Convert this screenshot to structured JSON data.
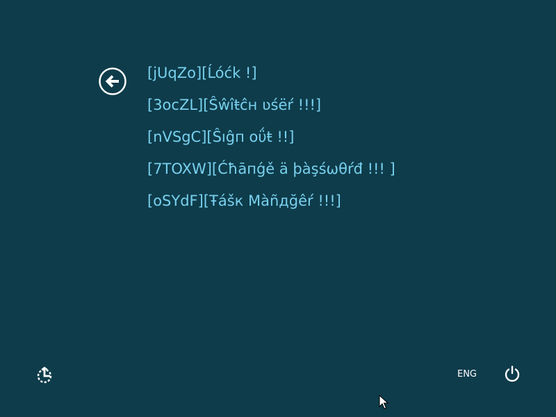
{
  "menu": {
    "items": [
      {
        "label": "[jUqZo][Ĺóćk !]"
      },
      {
        "label": "[3ocZL][Ŝŵîŧĉн ʋśëŕ !!!]"
      },
      {
        "label": "[nVSgC][Ŝıĝп oΰŧ !!]"
      },
      {
        "label": "[7TOXW][Ćħāпǵě ä þàşśωθŕđ !!! ]"
      },
      {
        "label": "[oSYdF][Ŧášк Màñдğêŕ !!!]"
      }
    ]
  },
  "bottom_bar": {
    "language": "ENG"
  },
  "icons": {
    "back": "back-arrow-icon",
    "accessibility": "ease-of-access-icon",
    "power": "power-icon"
  },
  "colors": {
    "background": "#0e3c4b",
    "menu_text": "#79d1ee",
    "icon": "#ffffff"
  }
}
